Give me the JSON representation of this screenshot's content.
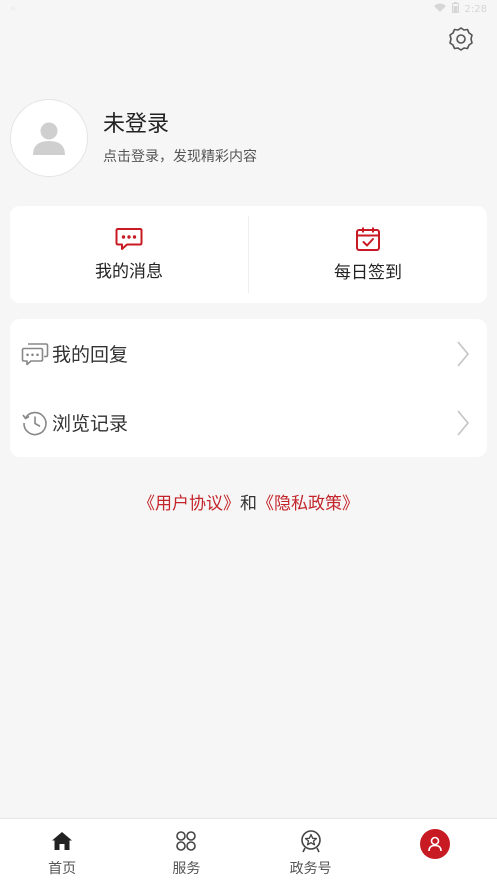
{
  "status": {
    "time": "2:28"
  },
  "profile": {
    "name": "未登录",
    "subtitle": "点击登录，发现精彩内容"
  },
  "quick_actions": [
    {
      "label": "我的消息",
      "icon": "message-icon"
    },
    {
      "label": "每日签到",
      "icon": "calendar-check-icon"
    }
  ],
  "list": [
    {
      "label": "我的回复",
      "icon": "reply-icon"
    },
    {
      "label": "浏览记录",
      "icon": "history-icon"
    }
  ],
  "agreement": {
    "user_agreement": "《用户协议》",
    "and": "和",
    "privacy_policy": "《隐私政策》"
  },
  "tabs": [
    {
      "label": "首页",
      "icon": "home-icon"
    },
    {
      "label": "服务",
      "icon": "services-icon"
    },
    {
      "label": "政务号",
      "icon": "gov-account-icon"
    },
    {
      "label": "",
      "icon": "profile-icon"
    }
  ],
  "colors": {
    "accent": "#c81a22",
    "background": "#f6f6f6",
    "card": "#ffffff"
  }
}
